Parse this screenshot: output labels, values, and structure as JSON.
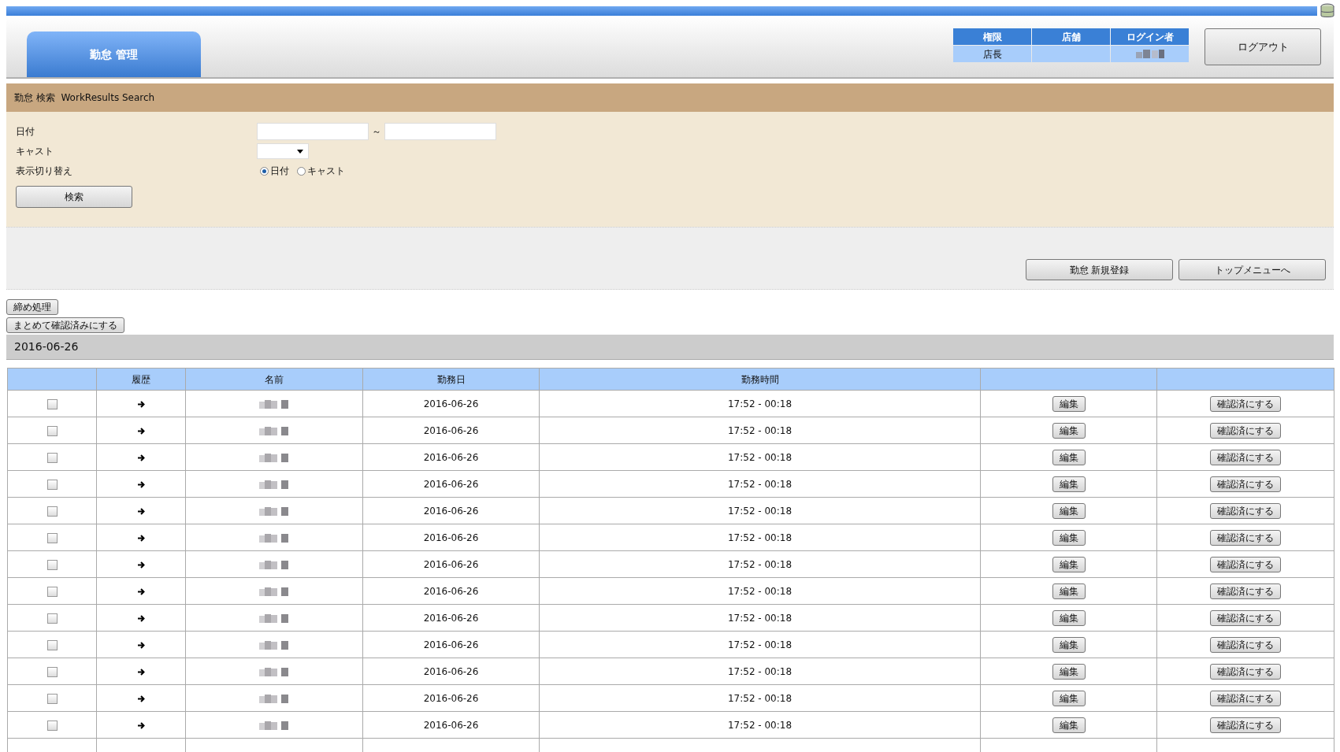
{
  "header": {
    "tab": "勤怠 管理",
    "info_columns": [
      "権限",
      "店舗",
      "ログイン者"
    ],
    "info_values": {
      "role": "店長"
    },
    "logout": "ログアウト"
  },
  "search_panel": {
    "title": "勤怠 検索  WorkResults Search",
    "fields": [
      {
        "kind": "range",
        "label": "日付",
        "separator": "～"
      },
      {
        "kind": "select",
        "label": "キャスト"
      },
      {
        "kind": "radio",
        "label": "表示切り替え",
        "options": [
          {
            "label": "日付",
            "selected": true
          },
          {
            "label": "キャスト",
            "selected": false
          }
        ]
      }
    ],
    "submit": "検索"
  },
  "actions": [
    "勤怠 新規登録",
    "トップメニューへ"
  ],
  "batch_buttons": [
    "締め処理",
    "まとめて確認済みにする"
  ],
  "date_heading": "2016-06-26",
  "table": {
    "columns": [
      "",
      "履歴",
      "名前",
      "勤務日",
      "勤務時間",
      "",
      ""
    ],
    "rows": [
      {
        "checked": false,
        "date": "2016-06-26",
        "time": "17:52 - 00:18",
        "edit": "編集",
        "confirm": "確認済にする"
      },
      {
        "checked": false,
        "date": "2016-06-26",
        "time": "17:52 - 00:18",
        "edit": "編集",
        "confirm": "確認済にする"
      },
      {
        "checked": false,
        "date": "2016-06-26",
        "time": "17:52 - 00:18",
        "edit": "編集",
        "confirm": "確認済にする"
      },
      {
        "checked": false,
        "date": "2016-06-26",
        "time": "17:52 - 00:18",
        "edit": "編集",
        "confirm": "確認済にする"
      },
      {
        "checked": false,
        "date": "2016-06-26",
        "time": "17:52 - 00:18",
        "edit": "編集",
        "confirm": "確認済にする"
      },
      {
        "checked": false,
        "date": "2016-06-26",
        "time": "17:52 - 00:18",
        "edit": "編集",
        "confirm": "確認済にする"
      },
      {
        "checked": false,
        "date": "2016-06-26",
        "time": "17:52 - 00:18",
        "edit": "編集",
        "confirm": "確認済にする"
      },
      {
        "checked": false,
        "date": "2016-06-26",
        "time": "17:52 - 00:18",
        "edit": "編集",
        "confirm": "確認済にする"
      },
      {
        "checked": false,
        "date": "2016-06-26",
        "time": "17:52 - 00:18",
        "edit": "編集",
        "confirm": "確認済にする"
      },
      {
        "checked": false,
        "date": "2016-06-26",
        "time": "17:52 - 00:18",
        "edit": "編集",
        "confirm": "確認済にする"
      },
      {
        "checked": false,
        "date": "2016-06-26",
        "time": "17:52 - 00:18",
        "edit": "編集",
        "confirm": "確認済にする"
      },
      {
        "checked": false,
        "date": "2016-06-26",
        "time": "17:52 - 00:18",
        "edit": "編集",
        "confirm": "確認済にする"
      },
      {
        "checked": false,
        "date": "2016-06-26",
        "time": "17:52 - 00:18",
        "edit": "編集",
        "confirm": "確認済にする"
      }
    ]
  }
}
